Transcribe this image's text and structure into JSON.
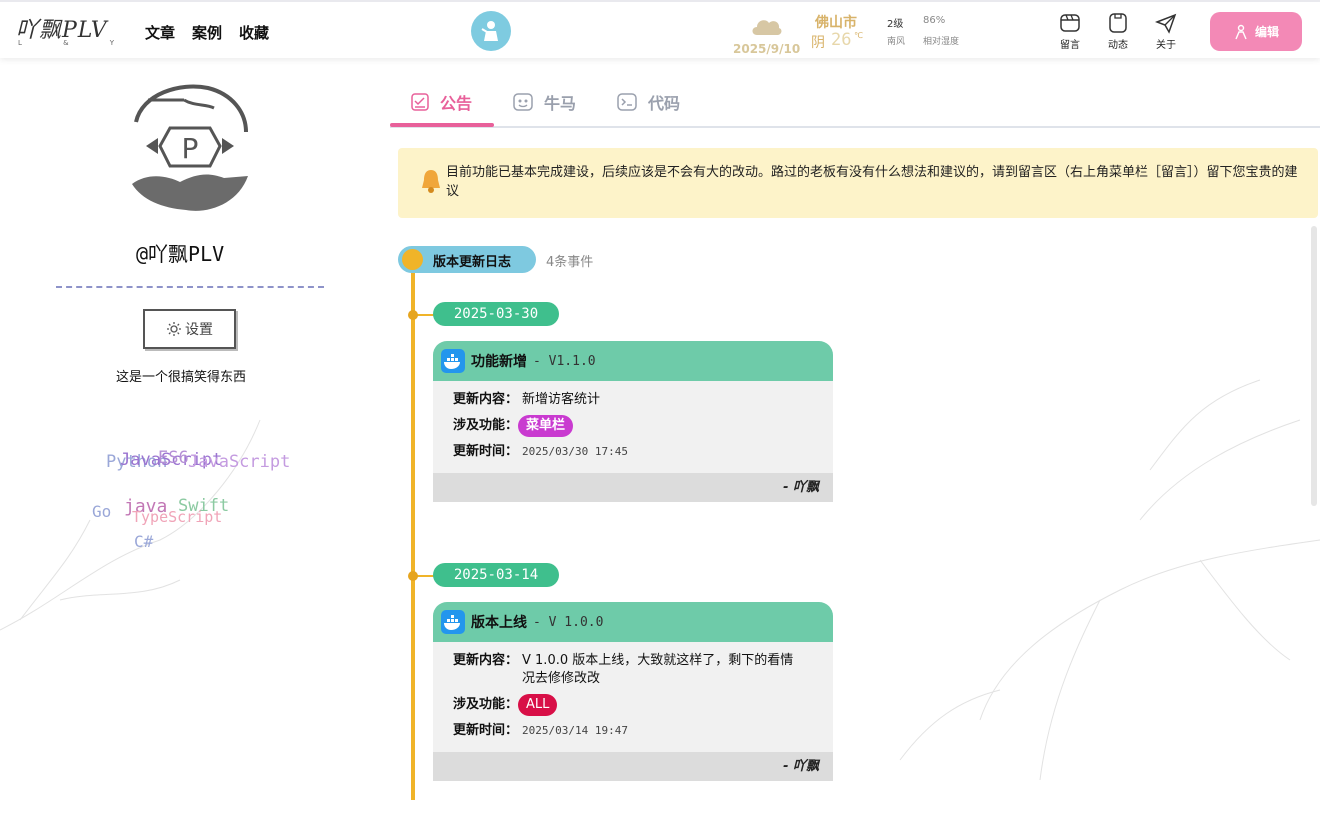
{
  "header": {
    "logo_text": "吖飘PLV",
    "logo_sub": [
      "L",
      "&",
      "Y"
    ],
    "nav": [
      "文章",
      "案例",
      "收藏"
    ],
    "weather": {
      "date": "2025/9/10",
      "city": "佛山市",
      "condition": "阴",
      "temp": "26",
      "unit": "℃",
      "wind_level": "2级",
      "wind_dir": "南风",
      "humidity": "86%",
      "humidity_label": "相对湿度"
    },
    "icons": [
      {
        "label": "留言",
        "icon": "message-icon"
      },
      {
        "label": "动态",
        "icon": "moments-icon"
      },
      {
        "label": "关于",
        "icon": "paper-plane-icon"
      }
    ],
    "edit_label": "编辑"
  },
  "sidebar": {
    "name": "@吖飘PLV",
    "settings_label": "设置",
    "bio": "这是一个很搞笑得东西",
    "tags": [
      {
        "text": "Python",
        "color": "#9aa7d8"
      },
      {
        "text": "JavaScript",
        "color": "#9b74d1"
      },
      {
        "text": "ES6",
        "color": "#b58fd6"
      },
      {
        "text": "JavaScript",
        "color": "#c49be0"
      },
      {
        "text": "Go",
        "color": "#9aa7d8"
      },
      {
        "text": "java",
        "color": "#c277b5"
      },
      {
        "text": "Swift",
        "color": "#8ccaa2"
      },
      {
        "text": "TypeScript",
        "color": "#f0a4b8"
      },
      {
        "text": "C#",
        "color": "#9aa7d8"
      }
    ]
  },
  "tabs": [
    {
      "label": "公告",
      "icon": "checklist-icon",
      "active": true
    },
    {
      "label": "牛马",
      "icon": "face-icon",
      "active": false
    },
    {
      "label": "代码",
      "icon": "terminal-icon",
      "active": false
    }
  ],
  "notice": "目前功能已基本完成建设，后续应该是不会有大的改动。路过的老板有没有什么想法和建议的，请到留言区（右上角菜单栏［留言］）留下您宝贵的建议",
  "timeline": {
    "title": "版本更新日志",
    "count": "4条事件",
    "events": [
      {
        "date": "2025-03-30",
        "title": "功能新增",
        "version": "- V1.1.0",
        "content_label": "更新内容：",
        "content": "新增访客统计",
        "feature_label": "涉及功能：",
        "feature": "菜单栏",
        "feature_color": "#c93ad0",
        "time_label": "更新时间：",
        "time": "2025/03/30 17:45",
        "author": "- 吖飘"
      },
      {
        "date": "2025-03-14",
        "title": "版本上线",
        "version": "- V 1.0.0",
        "content_label": "更新内容：",
        "content": "V 1.0.0 版本上线，大致就这样了，剩下的看情况去修修改改",
        "feature_label": "涉及功能：",
        "feature": "ALL",
        "feature_color": "#d80f47",
        "time_label": "更新时间：",
        "time": "2025/03/14 19:47",
        "author": "- 吖飘"
      }
    ]
  }
}
